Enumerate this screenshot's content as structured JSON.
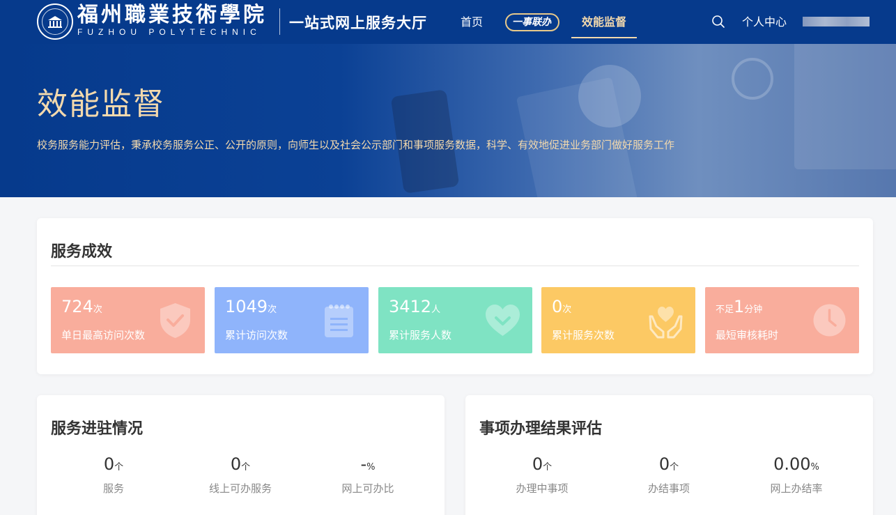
{
  "header": {
    "logo_cn": "福州職業技術學院",
    "logo_en": "FUZHOU POLYTECHNIC",
    "site_title": "一站式网上服务大厅",
    "nav": {
      "home": "首页",
      "yishi": "一事联办",
      "active": "效能监督"
    },
    "personal_center": "个人中心"
  },
  "banner": {
    "title": "效能监督",
    "subtitle": "校务服务能力评估，秉承校务服务公正、公开的原则，向师生以及社会公示部门和事项服务数据，科学、有效地促进业务部门做好服务工作"
  },
  "effect": {
    "title": "服务成效",
    "stats": [
      {
        "value": "724",
        "unit": "次",
        "label": "单日最高访问次数",
        "color": "#f9ad9c",
        "icon": "shield-check-icon"
      },
      {
        "value": "1049",
        "unit": "次",
        "label": "累计访问次数",
        "color": "#8fb4fb",
        "icon": "notepad-icon"
      },
      {
        "value": "3412",
        "unit": "人",
        "label": "累计服务人数",
        "color": "#7fe3c3",
        "icon": "heart-icon"
      },
      {
        "value": "0",
        "unit": "次",
        "label": "累计服务次数",
        "color": "#fcc964",
        "icon": "hands-heart-icon"
      },
      {
        "prefix": "不足",
        "value": "1",
        "unit": "分钟",
        "label": "最短审核耗时",
        "color": "#f9ad9c",
        "icon": "clock-icon"
      }
    ]
  },
  "settle": {
    "title": "服务进驻情况",
    "metrics": [
      {
        "value": "0",
        "unit": "个",
        "label": "服务"
      },
      {
        "value": "0",
        "unit": "个",
        "label": "线上可办服务"
      },
      {
        "value": "-",
        "unit": "%",
        "label": "网上可办比"
      }
    ]
  },
  "result": {
    "title": "事项办理结果评估",
    "metrics": [
      {
        "value": "0",
        "unit": "个",
        "label": "办理中事项"
      },
      {
        "value": "0",
        "unit": "个",
        "label": "办结事项"
      },
      {
        "value": "0.00",
        "unit": "%",
        "label": "网上办结率"
      }
    ]
  }
}
